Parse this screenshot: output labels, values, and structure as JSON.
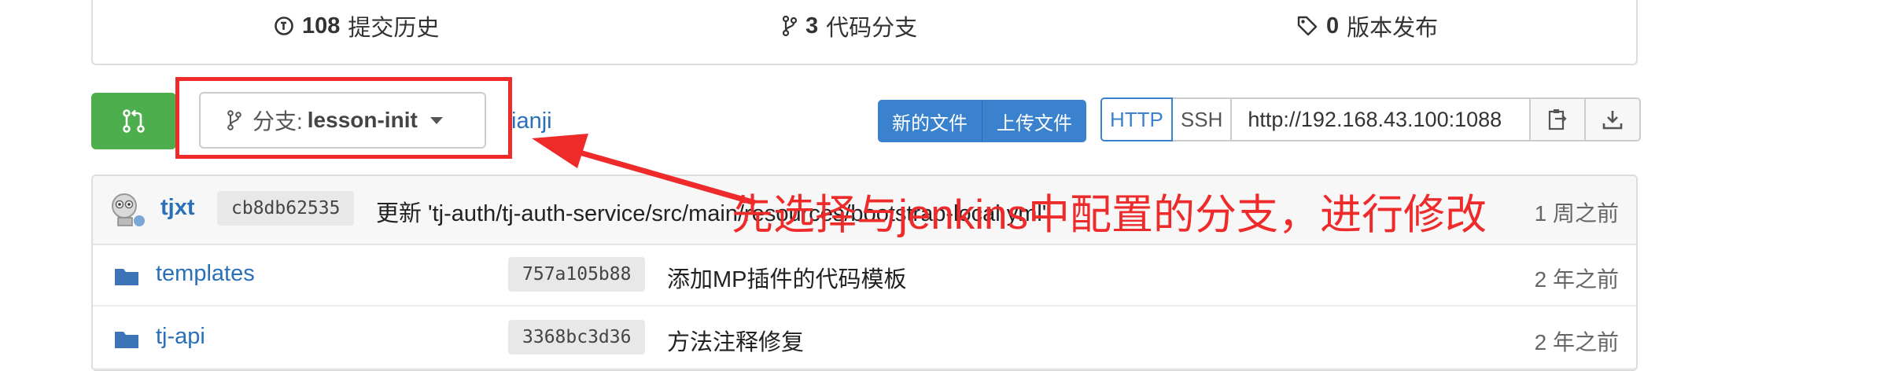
{
  "stats": {
    "commits_count": "108",
    "commits_label": "提交历史",
    "branches_count": "3",
    "branches_label": "代码分支",
    "releases_count": "0",
    "releases_label": "版本发布"
  },
  "toolbar": {
    "branch_prefix": "分支:",
    "branch_name": "lesson-init",
    "owner_fragment": "ianji",
    "new_file_label": "新的文件",
    "upload_file_label": "上传文件",
    "http_tab": "HTTP",
    "ssh_tab": "SSH",
    "clone_url": "http://192.168.43.100:1088"
  },
  "latest_commit": {
    "author": "tjxt",
    "sha": "cb8db62535",
    "message": "更新 'tj-auth/tj-auth-service/src/main/resources/bootstrap-local.yml'",
    "age": "1 周之前"
  },
  "files": [
    {
      "name": "templates",
      "sha": "757a105b88",
      "message": "添加MP插件的代码模板",
      "age": "2 年之前"
    },
    {
      "name": "tj-api",
      "sha": "3368bc3d36",
      "message": "方法注释修复",
      "age": "2 年之前"
    }
  ],
  "annotation": {
    "text": "先选择与jenkins中配置的分支，进行修改"
  },
  "colors": {
    "accent_green": "#4cae4c",
    "link_blue": "#2a70b8",
    "button_blue": "#3a82cd",
    "annotation_red": "#ee2a2a"
  }
}
